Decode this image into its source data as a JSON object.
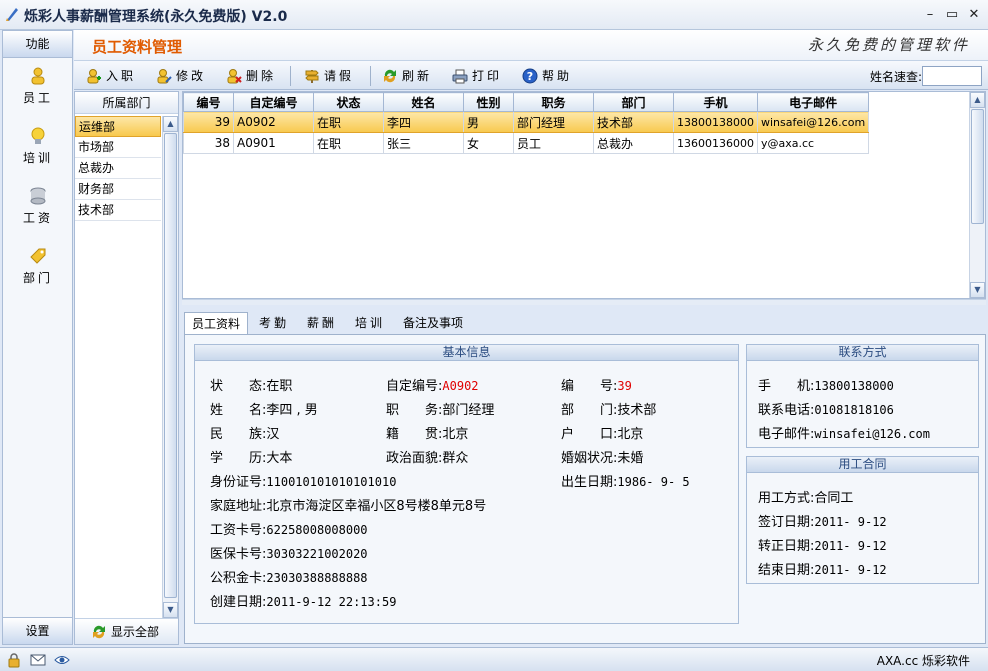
{
  "window": {
    "title": "烁彩人事薪酬管理系统(永久免费版) V2.0",
    "minimize": "–",
    "maximize": "▭",
    "close": "✕"
  },
  "sidebar": {
    "header": "功能",
    "items": [
      {
        "label": "员工",
        "icon": "person-icon"
      },
      {
        "label": "培训",
        "icon": "lightbulb-icon"
      },
      {
        "label": "工资",
        "icon": "coins-icon"
      },
      {
        "label": "部门",
        "icon": "tag-icon"
      }
    ],
    "footer": "设置"
  },
  "page": {
    "title": "员工资料管理",
    "slogan": "永久免费的管理软件"
  },
  "toolbar": {
    "add": "入职",
    "edit": "修改",
    "delete": "删除",
    "leave": "请假",
    "refresh": "刷新",
    "print": "打印",
    "help": "帮助",
    "quick_search_label": "姓名速查:",
    "quick_search_value": ""
  },
  "departments": {
    "header": "所属部门",
    "items": [
      "运维部",
      "市场部",
      "总裁办",
      "财务部",
      "技术部"
    ],
    "selected": 0,
    "show_all": "显示全部"
  },
  "grid": {
    "columns": [
      "编号",
      "自定编号",
      "状态",
      "姓名",
      "性别",
      "职务",
      "部门",
      "手机",
      "电子邮件"
    ],
    "rows": [
      [
        "39",
        "A0902",
        "在职",
        "李四",
        "男",
        "部门经理",
        "技术部",
        "13800138000",
        "winsafei@126.com"
      ],
      [
        "38",
        "A0901",
        "在职",
        "张三",
        "女",
        "员工",
        "总裁办",
        "13600136000",
        "y@axa.cc"
      ]
    ],
    "selected_row": 0
  },
  "tabs": [
    "员工资料",
    "考勤",
    "薪酬",
    "培训",
    "备注及事项"
  ],
  "basic_info": {
    "title": "基本信息",
    "status_label": "状　　态:",
    "status": "在职",
    "custom_no_label": "自定编号:",
    "custom_no": "A0902",
    "no_label": "编　　号:",
    "no": "39",
    "name_label": "姓　　名:",
    "name": "李四 , 男",
    "position_label": "职　　务:",
    "position": "部门经理",
    "dept_label": "部　　门:",
    "dept": "技术部",
    "ethnic_label": "民　　族:",
    "ethnic": "汉",
    "native_label": "籍　　贯:",
    "native": "北京",
    "hukou_label": "户　　口:",
    "hukou": "北京",
    "edu_label": "学　　历:",
    "edu": "大本",
    "political_label": "政治面貌:",
    "political": "群众",
    "marital_label": "婚姻状况:",
    "marital": "未婚",
    "id_label": "身份证号:",
    "id": "110010101010101010",
    "birth_label": "出生日期:",
    "birth": "1986- 9- 5",
    "address_label": "家庭地址:",
    "address": "北京市海淀区幸福小区8号楼8单元8号",
    "bankcard_label": "工资卡号:",
    "bankcard": "62258008008000",
    "medical_label": "医保卡号:",
    "medical": "30303221002020",
    "fund_label": "公积金卡:",
    "fund": "23030388888888",
    "created_label": "创建日期:",
    "created": "2011-9-12 22:13:59"
  },
  "contact": {
    "title": "联系方式",
    "mobile_label": "手　　机:",
    "mobile": "13800138000",
    "phone_label": "联系电话:",
    "phone": "01081818106",
    "email_label": "电子邮件:",
    "email": "winsafei@126.com"
  },
  "contract": {
    "title": "用工合同",
    "type_label": "用工方式:",
    "type": "合同工",
    "sign_label": "签订日期:",
    "sign": "2011- 9-12",
    "regular_label": "转正日期:",
    "regular": "2011- 9-12",
    "end_label": "结束日期:",
    "end": "2011- 9-12"
  },
  "statusbar": {
    "company": "AXA.cc 烁彩软件"
  },
  "colors": {
    "accent": "#e05a00",
    "selection": "#f8c94e",
    "highlight_value": "#e00000"
  }
}
